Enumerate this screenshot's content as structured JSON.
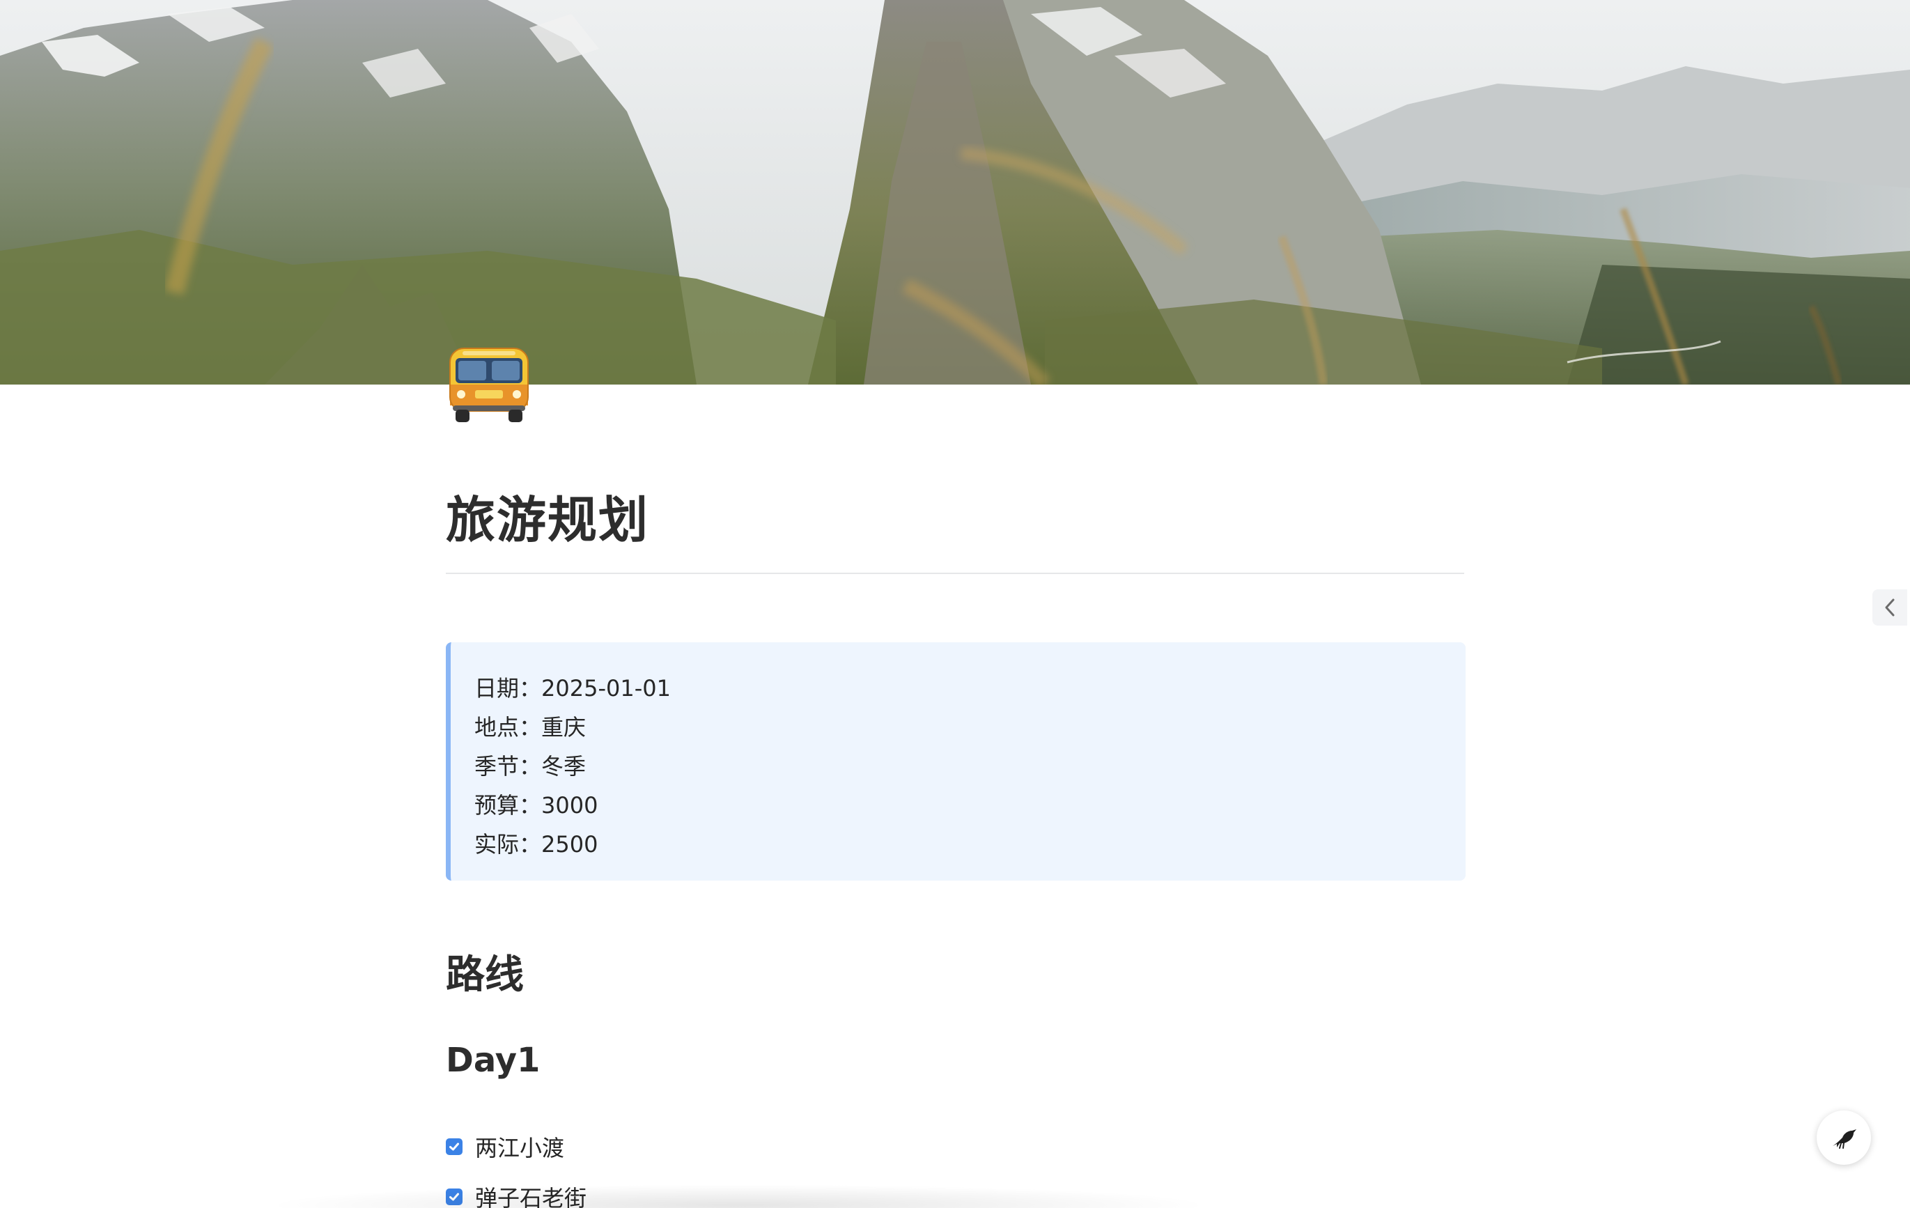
{
  "page": {
    "icon": "bus-icon",
    "title": "旅游规划"
  },
  "callout": {
    "accent_color": "#8ab6f5",
    "background_color": "#eef5fe",
    "lines": [
      {
        "label": "日期：",
        "value": "2025-01-01"
      },
      {
        "label": "地点：",
        "value": "重庆"
      },
      {
        "label": "季节：",
        "value": "冬季"
      },
      {
        "label": "预算：",
        "value": "3000"
      },
      {
        "label": "实际：",
        "value": "2500"
      }
    ]
  },
  "sections": {
    "route_heading": "路线",
    "day1_heading": "Day1",
    "todos": [
      {
        "text": "两江小渡",
        "checked": true
      },
      {
        "text": "弹子石老街",
        "checked": true
      }
    ]
  },
  "controls": {
    "outline_toggle_icon": "chevron-left-icon",
    "fab_icon": "bird-icon",
    "checkbox_color": "#3b82e6"
  }
}
